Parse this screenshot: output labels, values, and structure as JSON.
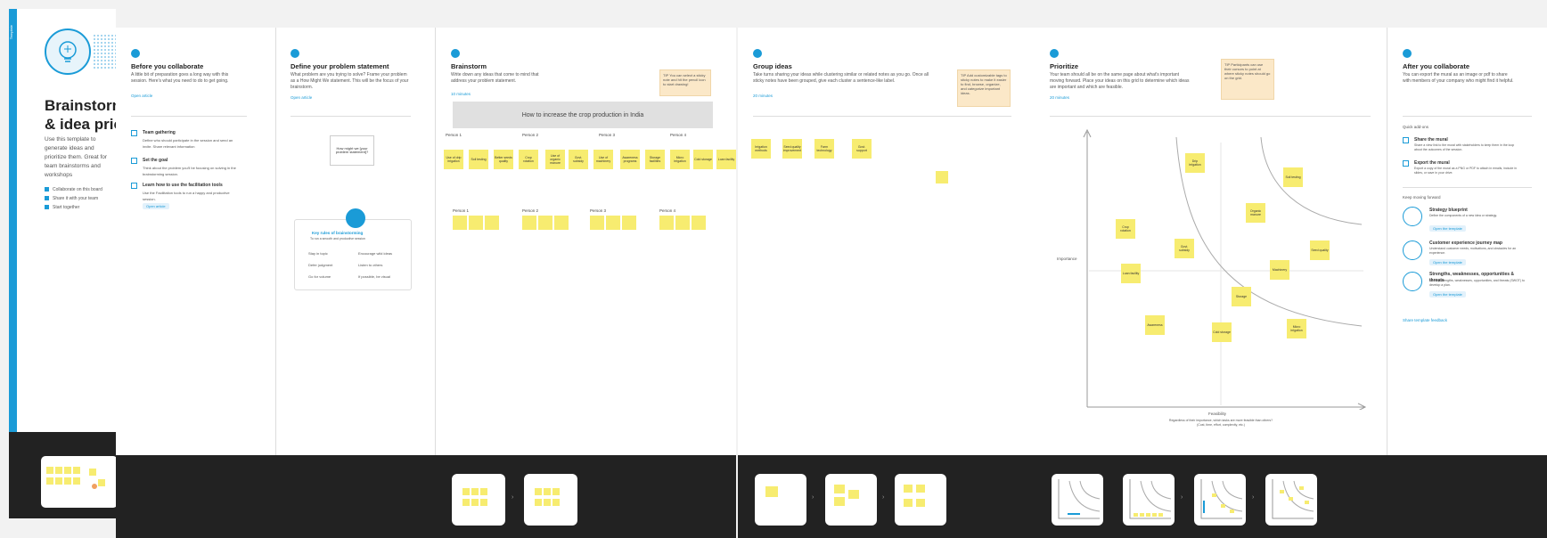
{
  "cover": {
    "strip_text": "Template",
    "title": "Brainstorm\n& idea priorit",
    "description": "Use this template to generate ideas and prioritize them. Great for team brainstorms and workshops",
    "meta": [
      "Collaborate on this board",
      "Share it with your team",
      "Start together"
    ]
  },
  "before": {
    "title": "Before you collaborate",
    "desc": "A little bit of preparation goes a long way with this session. Here's what you need to do to get going.",
    "link": "Open article",
    "steps": [
      {
        "title": "Team gathering",
        "desc": "Define who should participate in the session and send an invite. Share relevant information"
      },
      {
        "title": "Set the goal",
        "desc": "Think about the problem you'll be focusing on solving in the brainstorming session."
      },
      {
        "title": "Learn how to use the facilitation tools",
        "desc": "Use the Facilitation tools to run a happy and productive session."
      }
    ],
    "button": "Open article"
  },
  "define": {
    "title": "Define your problem statement",
    "desc": "What problem are you trying to solve? Frame your problem as a How Might We statement. This will be the focus of your brainstorm.",
    "link": "Open article",
    "card_text": "How might we [your problem statement]?",
    "facilitation_title": "Key rules of brainstorming",
    "facilitation_sub": "To run a smooth and productive session",
    "rules": [
      "Stay in topic",
      "Encourage wild ideas",
      "Defer judgment",
      "Listen to others",
      "Go for volume",
      "If possible, be visual"
    ]
  },
  "brainstorm": {
    "title": "Brainstorm",
    "desc": "Write down any ideas that come to mind that address your problem statement.",
    "link": "10 minutes",
    "note": "TIP You can select a sticky note and hit the pencil icon to start drawing!",
    "bar": "How to increase the crop production in India",
    "person_labels": [
      "Person 1",
      "Person 2",
      "Person 3",
      "Person 4"
    ],
    "group_labels": [
      "Person 1",
      "Person 2",
      "Person 3",
      "Person 4"
    ],
    "stickies": [
      "Use of drip irrigation",
      "Soil testing",
      "Better seeds quality",
      "Crop rotation",
      "Use of organic manure",
      "Govt. subsidy",
      "Use of machinery",
      "Awareness programs",
      "Storage facilities",
      "Micro irrigation",
      "Cold storage",
      "Loan facility"
    ]
  },
  "group": {
    "title": "Group ideas",
    "desc": "Take turns sharing your ideas while clustering similar or related notes as you go. Once all sticky notes have been grouped, give each cluster a sentence-like label.",
    "link": "20 minutes",
    "note": "TIP Add customizable tags to sticky notes to make it easier to find, browse, organize, and categorize important ideas.",
    "stickies": [
      "Irrigation methods",
      "Seed quality improvement",
      "Farm technology",
      "Govt. support",
      ""
    ]
  },
  "prioritize": {
    "title": "Prioritize",
    "desc": "Your team should all be on the same page about what's important moving forward. Place your ideas on this grid to determine which ideas are important and which are feasible.",
    "link": "20 minutes",
    "note": "TIP Participants can use their cursors to point at where sticky notes should go on the grid.",
    "y_label": "Importance",
    "x_label": "Feasibility",
    "x_sub": "Regardless of their importance, which tasks are more feasible than others? (Cost, time, effort, complexity, etc.)",
    "stickies": [
      "Drip irrigation",
      "Soil testing",
      "Organic manure",
      "Crop rotation",
      "Govt. subsidy",
      "Machinery",
      "Loan facility",
      "Storage",
      "Seed quality",
      "Awareness",
      "Cold storage",
      "Micro irrigation"
    ]
  },
  "after": {
    "title": "After you collaborate",
    "desc": "You can export the mural as an image or pdf to share with members of your company who might find it helpful.",
    "quick_add": "Quick add-ons",
    "checks": [
      {
        "title": "Share the mural",
        "desc": "Share a view link to the mural with stakeholders to keep them in the loop about the outcomes of the session."
      },
      {
        "title": "Export the mural",
        "desc": "Export a copy of the mural as a PNG or PDF to attach in emails, include in slides, or save in your drive."
      }
    ],
    "keep_moving": "Keep moving forward",
    "templates": [
      {
        "title": "Strategy blueprint",
        "desc": "Define the components of a new idea or strategy.",
        "btn": "Open the template"
      },
      {
        "title": "Customer experience journey map",
        "desc": "Understand customer needs, motivations, and obstacles for an experience.",
        "btn": "Open the template"
      },
      {
        "title": "Strengths, weaknesses, opportunities & threats",
        "desc": "Identify strengths, weaknesses, opportunities, and threats (SWOT) to develop a plan.",
        "btn": "Open the template"
      }
    ],
    "feedback": "Share template feedback"
  }
}
